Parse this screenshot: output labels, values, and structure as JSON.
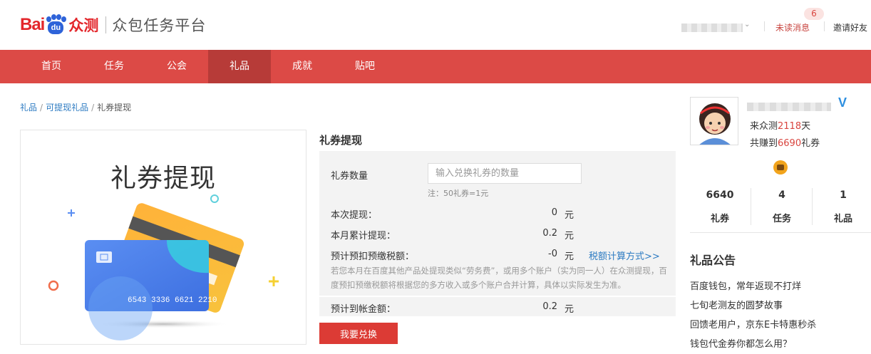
{
  "header": {
    "logo_bai": "Bai",
    "logo_du": "du",
    "logo_zhongce": "众测",
    "platform_title": "众包任务平台",
    "unread_label": "未读消息",
    "unread_count": "6",
    "invite_label": "邀请好友",
    "dropdown_icon": "chevron-down-icon"
  },
  "nav": {
    "items": [
      "首页",
      "任务",
      "公会",
      "礼品",
      "成就",
      "贴吧"
    ],
    "active": "礼品"
  },
  "breadcrumb": {
    "items": [
      "礼品",
      "可提现礼品",
      "礼券提现"
    ]
  },
  "hero": {
    "title": "礼券提现",
    "card_number": "6543 3336 6621 2210"
  },
  "form": {
    "section_title": "礼券提现",
    "quantity_label": "礼券数量",
    "quantity_value": "",
    "quantity_placeholder": "输入兑换礼券的数量",
    "note": "注：50礼券=1元",
    "current_withdraw_label": "本次提现：",
    "current_withdraw_value": "0",
    "unit": "元",
    "monthly_total_label": "本月累计提现：",
    "monthly_total_value": "0.2",
    "tax_label": "预计预扣预缴税额：",
    "tax_value": "-0",
    "tax_link": "税额计算方式>>",
    "tax_desc": "若您本月在百度其他产品处提现类似“劳务费”，或用多个账户（实为同一人）在众测提现，百度预扣预缴税额将根据您的多方收入或多个账户合并计算，具体以实际发生为准。",
    "arrival_label": "预计到帐金额：",
    "arrival_value": "0.2",
    "submit_label": "我要兑换"
  },
  "profile": {
    "verified_badge": "V",
    "days_prefix": "来众测",
    "days_value": "2118",
    "days_suffix": "天",
    "earned_prefix": "共赚到",
    "earned_value": "6690",
    "earned_suffix": "礼券",
    "stats": [
      {
        "num": "6640",
        "label": "礼券"
      },
      {
        "num": "4",
        "label": "任务"
      },
      {
        "num": "1",
        "label": "礼品"
      }
    ]
  },
  "announcements": {
    "title": "礼品公告",
    "items": [
      "百度钱包，常年返现不打烊",
      "七旬老测友的圆梦故事",
      "回馈老用户，京东E卡特惠秒杀",
      "钱包代金券你都怎么用？"
    ]
  },
  "colors": {
    "brand_red": "#dc4a46",
    "active_nav": "#b73b38",
    "link_blue": "#2d7bc2",
    "button_red": "#dc3b35"
  }
}
